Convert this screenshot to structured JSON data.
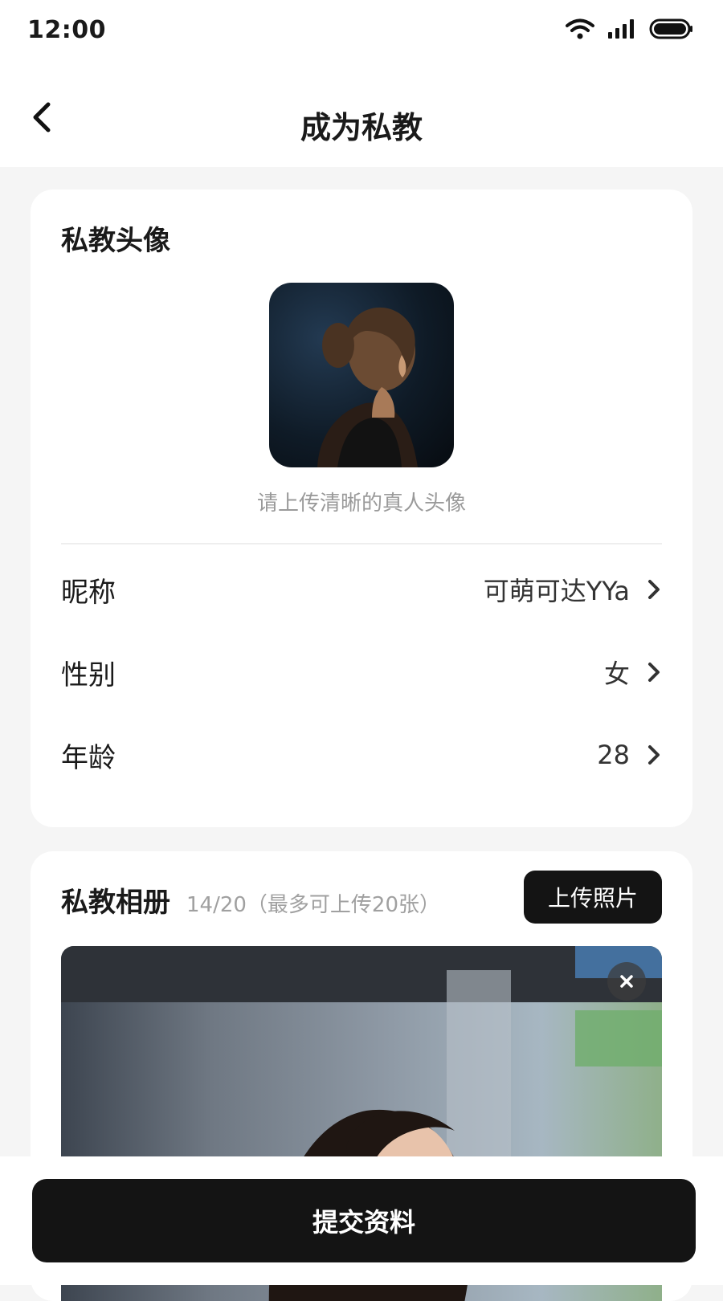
{
  "status_bar": {
    "time": "12:00"
  },
  "header": {
    "title": "成为私教"
  },
  "avatar_section": {
    "title": "私教头像",
    "hint": "请上传清晰的真人头像"
  },
  "profile_rows": [
    {
      "label": "昵称",
      "value": "可萌可达YYa"
    },
    {
      "label": "性别",
      "value": "女"
    },
    {
      "label": "年龄",
      "value": "28"
    }
  ],
  "album_section": {
    "title": "私教相册",
    "count_text": "14/20（最多可上传20张）",
    "upload_label": "上传照片"
  },
  "footer": {
    "submit_label": "提交资料"
  },
  "colors": {
    "primary_button": "#141414",
    "page_bg": "#f5f5f5",
    "card_bg": "#ffffff"
  }
}
